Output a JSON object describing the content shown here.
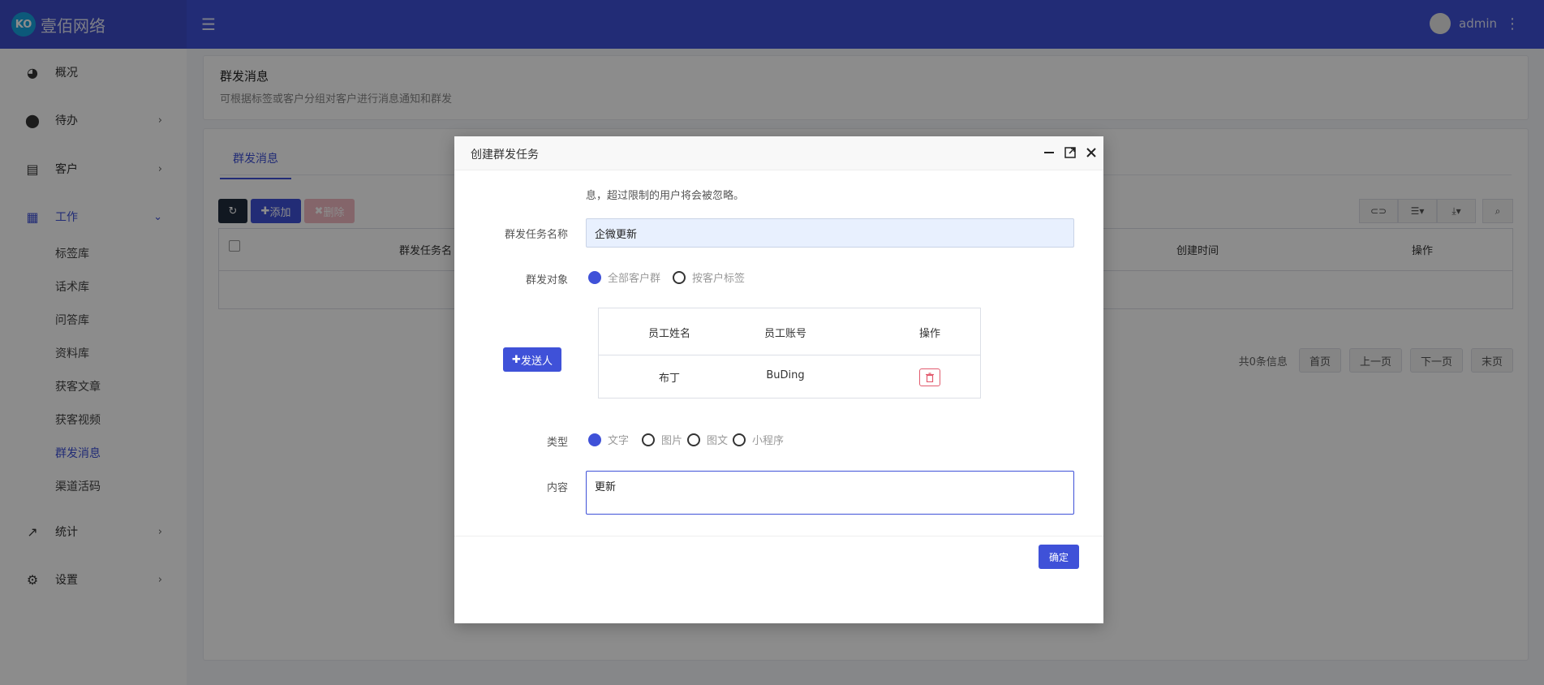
{
  "brand": {
    "logo_text": "KO",
    "name": "壹佰网络"
  },
  "header": {
    "menu_icon": "☰",
    "user_name": "admin",
    "more_icon": "⋮"
  },
  "sidebar": {
    "items": [
      {
        "label": "概况",
        "icon": "dashboard-icon"
      },
      {
        "label": "待办",
        "icon": "compass-icon"
      },
      {
        "label": "客户",
        "icon": "id-card-icon"
      },
      {
        "label": "工作",
        "icon": "grid-icon"
      },
      {
        "label": "统计",
        "icon": "chart-line-icon"
      },
      {
        "label": "设置",
        "icon": "gear-icon"
      }
    ],
    "work_sub": [
      "标签库",
      "话术库",
      "问答库",
      "资料库",
      "获客文章",
      "获客视频",
      "群发消息",
      "渠道活码"
    ]
  },
  "page": {
    "title": "群发消息",
    "desc": "可根据标签或客户分组对客户进行消息通知和群发",
    "tab": "群发消息",
    "add_label": "添加",
    "delete_label": "删除",
    "columns": [
      "群发任务名",
      "创建时间",
      "操作"
    ],
    "pager": {
      "info": "共0条信息",
      "first": "首页",
      "prev": "上一页",
      "next": "下一页",
      "last": "末页"
    }
  },
  "modal": {
    "title": "创建群发任务",
    "notice": "息，超过限制的用户将会被忽略。",
    "name_label": "群发任务名称",
    "name_value": "企微更新",
    "target_label": "群发对象",
    "target_options": [
      "全部客户群",
      "按客户标签"
    ],
    "sender_button": "发送人",
    "staff_columns": [
      "员工姓名",
      "员工账号",
      "操作"
    ],
    "staff_rows": [
      {
        "name": "布丁",
        "account": "BuDing"
      }
    ],
    "type_label": "类型",
    "type_options": [
      "文字",
      "图片",
      "图文",
      "小程序"
    ],
    "content_label": "内容",
    "content_value": "更新",
    "confirm_label": "确定"
  }
}
